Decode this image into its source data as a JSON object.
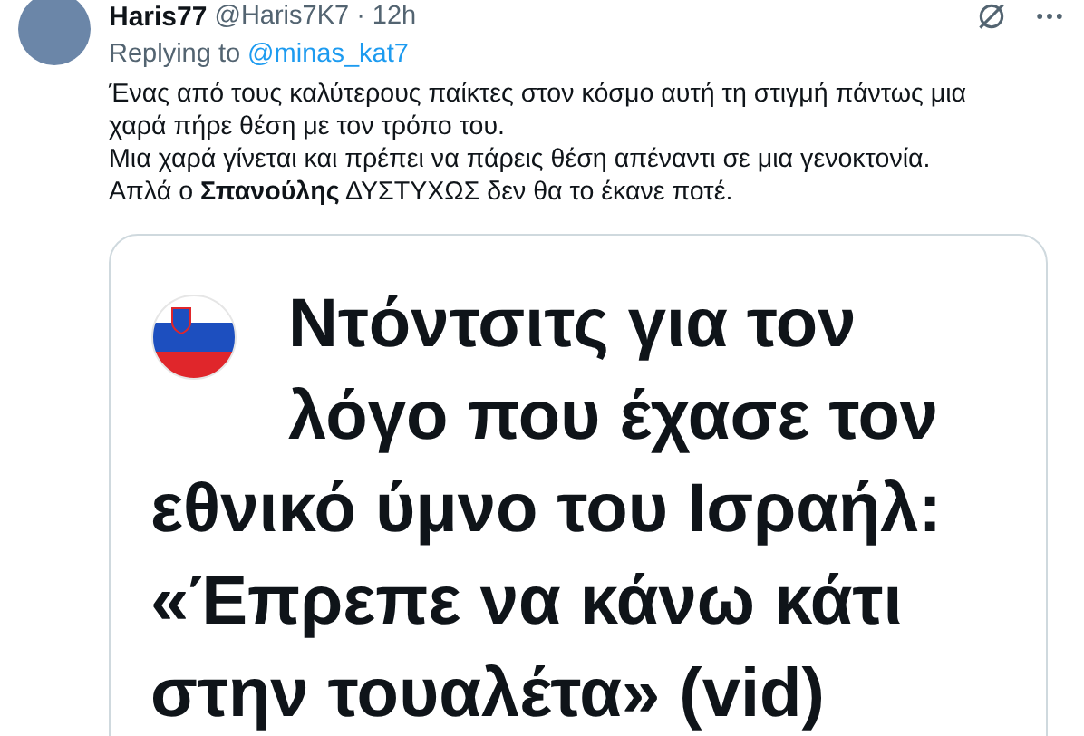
{
  "tweet": {
    "display_name": "Haris77",
    "handle": "@Haris7K7",
    "separator": "·",
    "time": "12h",
    "replying_label": "Replying to",
    "replying_to": "@minas_kat7",
    "lines": [
      "Ένας από τους καλύτερους παίκτες στον κόσμο αυτή τη στιγμή πάντως μια",
      "χαρά πήρε θέση με τον τρόπο του.",
      "Μια χαρά γίνεται και πρέπει να πάρεις θέση απέναντι σε μια γενοκτονία.",
      "Απλά ο **Σπανούλης** ΔΥΣΤΥΧΩΣ δεν θα το έκανε ποτέ."
    ],
    "card": {
      "headline_lines": [
        "Ντόντσιτς για τον",
        "λόγο που έχασε τον",
        "εθνικό ύμνο του Ισραήλ:",
        "«Έπρεπε να κάνω κάτι",
        "στην τουαλέτα» (vid)"
      ]
    }
  }
}
